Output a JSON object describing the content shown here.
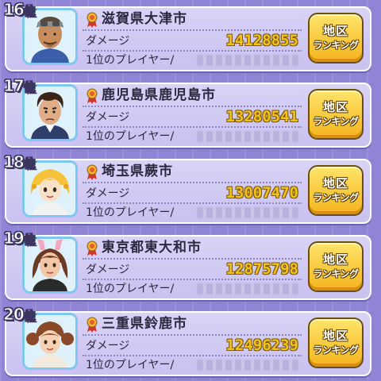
{
  "ranking": {
    "rows": [
      {
        "rank_num": "16",
        "rank_suffix": "位",
        "city": "滋賀県大津市",
        "damage_label": "ダメージ",
        "damage": "14128855",
        "player_label": "1位のプレイヤー/",
        "button_line1": "地区",
        "button_line2": "ランキング",
        "avatar_icon": "man-sunglasses-avatar-icon"
      },
      {
        "rank_num": "17",
        "rank_suffix": "位",
        "city": "鹿児島県鹿児島市",
        "damage_label": "ダメージ",
        "damage": "13280541",
        "player_label": "1位のプレイヤー/",
        "button_line1": "地区",
        "button_line2": "ランキング",
        "avatar_icon": "man-dark-hair-avatar-icon"
      },
      {
        "rank_num": "18",
        "rank_suffix": "位",
        "city": "埼玉県蕨市",
        "damage_label": "ダメージ",
        "damage": "13007470",
        "player_label": "1位のプレイヤー/",
        "button_line1": "地区",
        "button_line2": "ランキング",
        "avatar_icon": "blonde-child-avatar-icon"
      },
      {
        "rank_num": "19",
        "rank_suffix": "位",
        "city": "東京都東大和市",
        "damage_label": "ダメージ",
        "damage": "12875798",
        "player_label": "1位のプレイヤー/",
        "button_line1": "地区",
        "button_line2": "ランキング",
        "avatar_icon": "girl-bunny-ears-avatar-icon"
      },
      {
        "rank_num": "20",
        "rank_suffix": "位",
        "city": "三重県鈴鹿市",
        "damage_label": "ダメージ",
        "damage": "12496239",
        "player_label": "1位のプレイヤー/",
        "button_line1": "地区",
        "button_line2": "ランキング",
        "avatar_icon": "girl-pigtails-avatar-icon"
      }
    ]
  },
  "colors": {
    "background": "#8f84d6",
    "card": "#d4cdf4",
    "damage_number": "#f4c21b",
    "button": "#fbc933",
    "avatar_frame": "#7ec8f0"
  }
}
